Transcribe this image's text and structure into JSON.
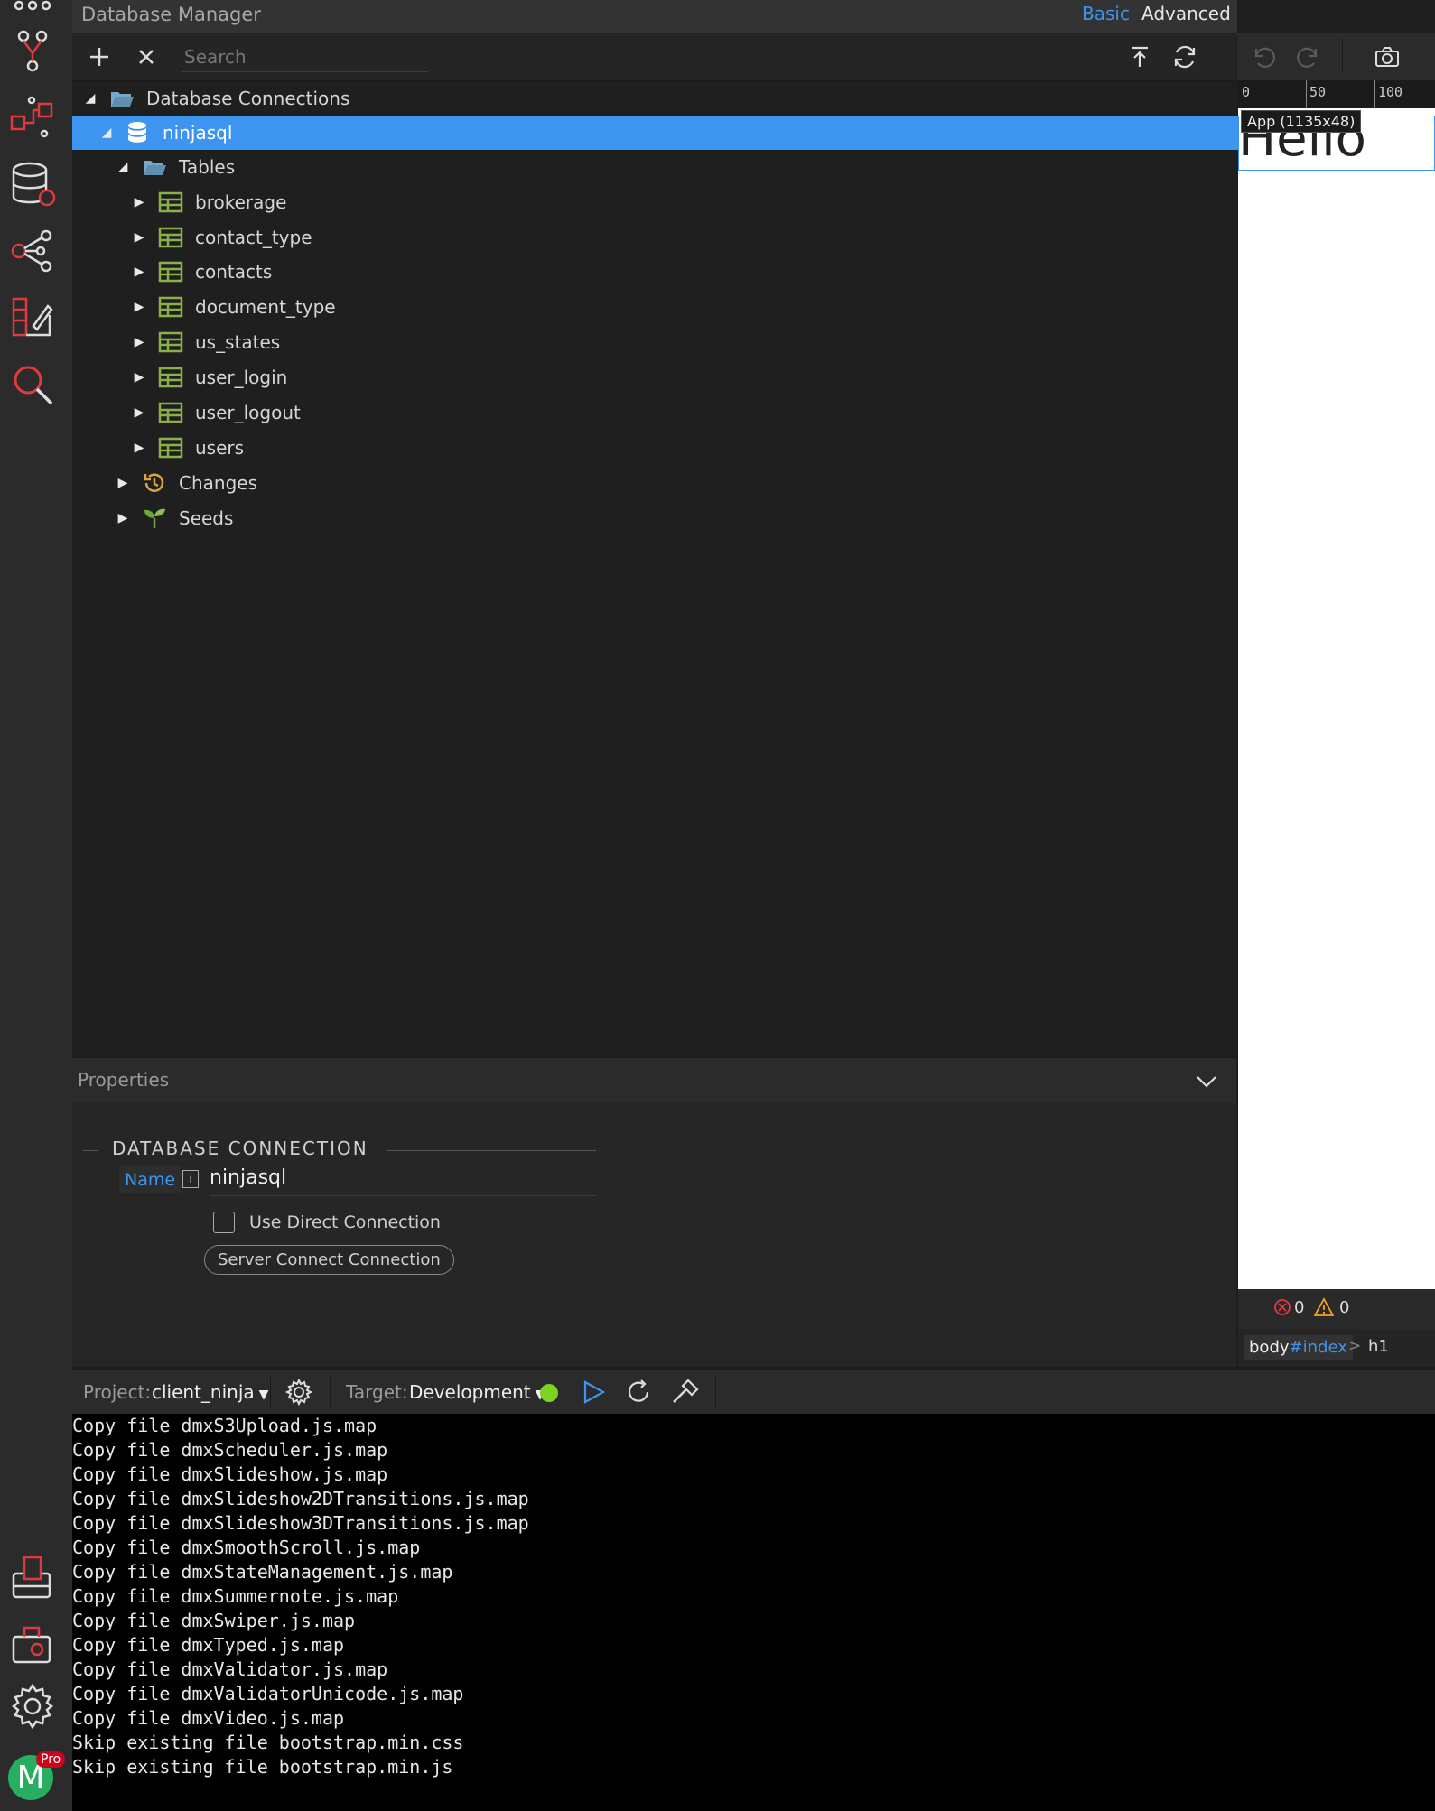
{
  "app": {
    "panel_title": "Database Manager",
    "modes": [
      "Basic",
      "Advanced"
    ],
    "active_mode": "Basic",
    "accent": "#3d95f0",
    "activity_icons": [
      "branch-icon",
      "flow-icon",
      "database-icon",
      "share-icon",
      "design-icon",
      "search-icon",
      "publish-icon",
      "extensions-icon",
      "settings-icon",
      "avatar"
    ],
    "user": {
      "initial": "M",
      "badge": "Pro"
    }
  },
  "toolbar": {
    "search_placeholder": "Search",
    "icons": [
      "add-icon",
      "close-icon",
      "upload-icon",
      "refresh-icon"
    ]
  },
  "tree": {
    "root_label": "Database Connections",
    "connection_label": "ninjasql",
    "tables_label": "Tables",
    "tables": [
      "brokerage",
      "contact_type",
      "contacts",
      "document_type",
      "us_states",
      "user_login",
      "user_logout",
      "users"
    ],
    "changes_label": "Changes",
    "seeds_label": "Seeds"
  },
  "properties": {
    "header": "Properties",
    "section_title": "DATABASE CONNECTION",
    "name_label": "Name",
    "name_value": "ninjasql",
    "direct_connection_label": "Use Direct Connection",
    "direct_connection_checked": false,
    "server_connect_button": "Server Connect Connection"
  },
  "preview": {
    "ruler_ticks": [
      "0",
      "50",
      "100"
    ],
    "tooltip": "App (1135x48)",
    "heading_text": "Hello",
    "errors_count": "0",
    "warnings_count": "0",
    "breadcrumb_body": "body",
    "breadcrumb_id": "#index",
    "breadcrumb_sep": ">",
    "breadcrumb_current": "h1"
  },
  "bottom_bar": {
    "project_label": "Project:",
    "project_value": "client_ninja",
    "target_label": "Target:",
    "target_value": "Development",
    "status_color": "#7ed321"
  },
  "console": {
    "lines": [
      "Copy file dmxS3Upload.js.map",
      "Copy file dmxScheduler.js.map",
      "Copy file dmxSlideshow.js.map",
      "Copy file dmxSlideshow2DTransitions.js.map",
      "Copy file dmxSlideshow3DTransitions.js.map",
      "Copy file dmxSmoothScroll.js.map",
      "Copy file dmxStateManagement.js.map",
      "Copy file dmxSummernote.js.map",
      "Copy file dmxSwiper.js.map",
      "Copy file dmxTyped.js.map",
      "Copy file dmxValidator.js.map",
      "Copy file dmxValidatorUnicode.js.map",
      "Copy file dmxVideo.js.map",
      "Skip existing file bootstrap.min.css",
      "Skip existing file bootstrap.min.js"
    ]
  }
}
